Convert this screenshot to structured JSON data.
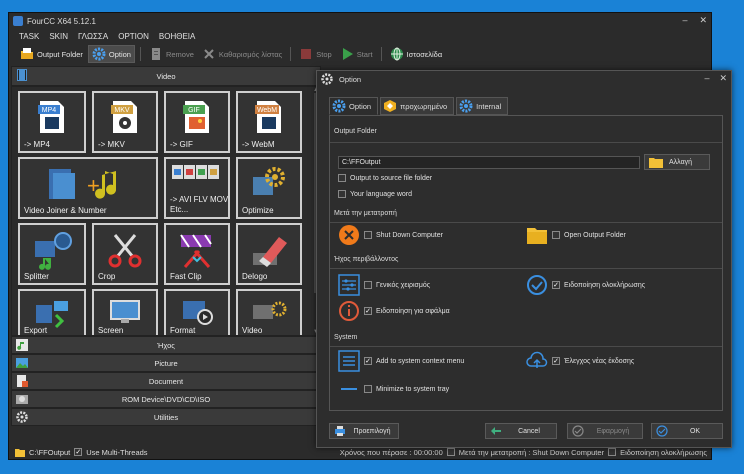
{
  "app": {
    "title": "FourCC X64 5.12.1"
  },
  "menu": [
    "TASK",
    "SKIN",
    "ΓΛΩΣΣΑ",
    "OPTION",
    "ΒΟΗΘΕΙΑ"
  ],
  "toolbar": {
    "output_folder": "Output Folder",
    "option": "Option",
    "remove": "Remove",
    "clear_list": "Καθαρισμός λίστας",
    "stop": "Stop",
    "start": "Start",
    "website": "Ιστοσελίδα"
  },
  "left_panel": {
    "video_header": "Video",
    "tiles": [
      {
        "label": "-> MP4",
        "badge": "MP4"
      },
      {
        "label": "-> MKV",
        "badge": "MKV"
      },
      {
        "label": "-> GIF",
        "badge": "GIF"
      },
      {
        "label": "-> WebM",
        "badge": "WebM"
      },
      {
        "label": "Video Joiner & Number"
      },
      {
        "label": "-> AVI FLV MOV Etc..."
      },
      {
        "label": "Optimize"
      },
      {
        "label": "Splitter"
      },
      {
        "label": "Crop"
      },
      {
        "label": "Fast Clip"
      },
      {
        "label": "Delogo"
      },
      {
        "label": "Export"
      },
      {
        "label": "Screen"
      },
      {
        "label": "Format"
      },
      {
        "label": "Video"
      }
    ],
    "categories": [
      "Ήχος",
      "Picture",
      "Document",
      "ROM Device\\DVD\\CD\\ISO",
      "Utilities"
    ]
  },
  "status": {
    "path": "C:\\FFOutput",
    "multi_threads": "Use Multi-Threads",
    "right_text": "Χρόνος που πέρασε : 00:00:00",
    "shutdown": "Μετά την μετατροπή : Shut Down Computer",
    "notify": "Ειδοποίηση ολοκλήρωσης"
  },
  "dialog": {
    "title": "Option",
    "tabs": [
      "Option",
      "προχωρημένο",
      "Internal"
    ],
    "output_folder_section": "Output Folder",
    "path_value": "C:\\FFOutput",
    "browse_label": "Αλλαγή",
    "output_to_source": "Output to source file folder",
    "your_language_word": "Your language word",
    "after_convert_section": "Μετά την μετατροπή",
    "shut_down": "Shut Down Computer",
    "open_output_folder": "Open Output Folder",
    "sound_env_section": "Ήχος περιβάλλοντος",
    "general_handling": "Γενικός χειρισμός",
    "completion_notify": "Ειδοποίηση ολοκλήρωσης",
    "error_notify": "Ειδοποίηση για σφάλμα",
    "system_section": "System",
    "add_context_menu": "Add to system context menu",
    "check_new_version": "Έλεγχος νέας έκδοσης",
    "minimize_tray": "Minimize to system tray",
    "buttons": {
      "default": "Προεπιλογή",
      "cancel": "Cancel",
      "apply": "Εφαρμογή",
      "ok": "OK"
    }
  },
  "colors": {
    "desktop": "#1a82d6",
    "window_bg": "#2b2b2b",
    "accent_blue": "#3a8fe0",
    "orange": "#f07a1a",
    "folder_yellow": "#f2c037",
    "error_red": "#e05a3a"
  }
}
